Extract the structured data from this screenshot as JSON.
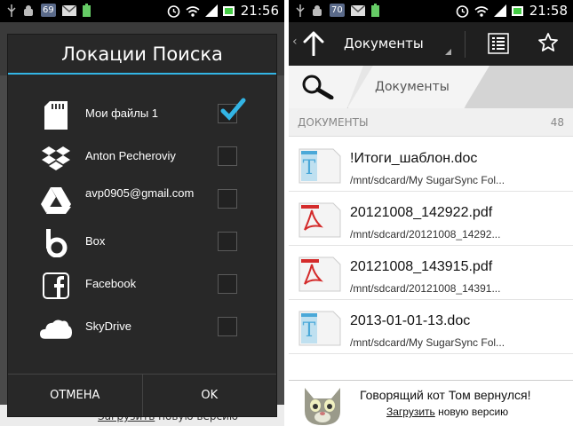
{
  "status_left": {
    "notif_badge": "69",
    "time": "21:56"
  },
  "status_right": {
    "notif_badge": "70",
    "time": "21:58"
  },
  "dialog": {
    "title": "Локации Поиска",
    "locations": [
      {
        "label": "Мои файлы 1",
        "icon": "sdcard-icon",
        "checked": true
      },
      {
        "label": "Anton Pecheroviy",
        "icon": "dropbox-icon",
        "checked": false
      },
      {
        "label": "avp0905@gmail.com",
        "icon": "google-drive-icon",
        "checked": false
      },
      {
        "label": "Box",
        "icon": "box-icon",
        "checked": false
      },
      {
        "label": "Facebook",
        "icon": "facebook-icon",
        "checked": false
      },
      {
        "label": "SkyDrive",
        "icon": "skydrive-icon",
        "checked": false
      }
    ],
    "cancel_label": "ОТМЕНА",
    "ok_label": "OK"
  },
  "left_banner": {
    "link": "Загрузить",
    "rest": " новую версию"
  },
  "actionbar": {
    "title": "Документы"
  },
  "breadcrumb": {
    "folder": "Документы"
  },
  "section": {
    "title": "ДОКУМЕНТЫ",
    "count": "48"
  },
  "files": [
    {
      "name": "!Итоги_шаблон.doc",
      "path": "/mnt/sdcard/My SugarSync Fol...",
      "type": "doc"
    },
    {
      "name": "20121008_142922.pdf",
      "path": "/mnt/sdcard/20121008_14292...",
      "type": "pdf"
    },
    {
      "name": "20121008_143915.pdf",
      "path": "/mnt/sdcard/20121008_14391...",
      "type": "pdf"
    },
    {
      "name": "2013-01-01-13.doc",
      "path": "/mnt/sdcard/My SugarSync Fol...",
      "type": "doc"
    }
  ],
  "ad": {
    "title": "Говорящий кот Том вернулся!",
    "link": "Загрузить",
    "rest": " новую версию"
  },
  "colors": {
    "accent": "#33b5e5",
    "dialog_bg": "#282828",
    "actionbar_bg": "#1f1f1f",
    "pdf_red": "#d42b2b",
    "doc_blue": "#4aa8d8"
  }
}
